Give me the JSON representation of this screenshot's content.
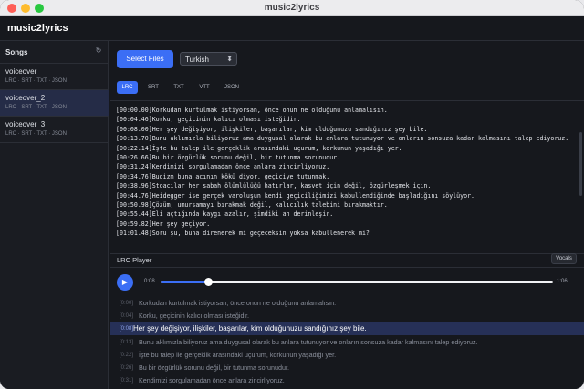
{
  "window": {
    "title": "music2lyrics"
  },
  "app": {
    "name": "music2lyrics"
  },
  "sidebar": {
    "title": "Songs",
    "refresh_icon": "refresh-icon",
    "songs": [
      {
        "name": "voiceover",
        "formats": "LRC · SRT · TXT · JSON"
      },
      {
        "name": "voiceover_2",
        "formats": "LRC · SRT · TXT · JSON"
      },
      {
        "name": "voiceover_3",
        "formats": "LRC · SRT · TXT · JSON"
      }
    ],
    "active_index": 1
  },
  "toolbar": {
    "select_files_label": "Select Files",
    "language_value": "Turkish",
    "language_chevron": "⬍"
  },
  "format_tabs": [
    {
      "label": "LRC",
      "active": true
    },
    {
      "label": "SRT",
      "active": false
    },
    {
      "label": "TXT",
      "active": false
    },
    {
      "label": "VTT",
      "active": false
    },
    {
      "label": "JSON",
      "active": false
    }
  ],
  "lyrics_lines": [
    "[00:00.00]Korkudan kurtulmak istiyorsan, önce onun ne olduğunu anlamalısın.",
    "[00:04.46]Korku, geçicinin kalıcı olması isteğidir.",
    "[00:08.00]Her şey değişiyor, ilişkiler, başarılar, kim olduğunuzu sandığınız şey bile.",
    "[00:13.70]Bunu aklımızla biliyoruz ama duygusal olarak bu anlara tutunuyor ve onların sonsuza kadar kalmasını talep ediyoruz.",
    "[00:22.14]İşte bu talep ile gerçeklik arasındaki uçurum, korkunun yaşadığı yer.",
    "[00:26.66]Bu bir özgürlük sorunu değil, bir tutunma sorunudur.",
    "[00:31.24]Kendimizi sorgulamadan önce anlara zincirliyoruz.",
    "[00:34.76]Budizm buna acının kökü diyor, geçiciye tutunmak.",
    "[00:38.96]Stoacılar her sabah ölümlülüğü hatırlar, kasvet için değil, özgürleşmek için.",
    "[00:44.76]Heidegger ise gerçek varoluşun kendi geçiciliğimizi kabullendiğinde başladığını söylüyor.",
    "[00:50.98]Çözüm, umursamayı bırakmak değil, kalıcılık talebini bırakmaktır.",
    "[00:55.44]Eli açtığında kaygı azalır, şimdiki an derinleşir.",
    "[00:59.82]Her şey geçiyor.",
    "[01:01.48]Soru şu, buna direnerek mi geçeceksin yoksa kabullenerek mi?"
  ],
  "player": {
    "title": "LRC Player",
    "vocals_label": "Vocals",
    "play_icon": "▶",
    "current_time": "0:08",
    "duration": "1:06",
    "progress": 0.121,
    "lines": [
      {
        "ts": "[0:00]",
        "text": "Korkudan kurtulmak istiyorsan, önce onun ne olduğunu anlamalısın.",
        "current": false
      },
      {
        "ts": "[0:04]",
        "text": "Korku, geçicinin kalıcı olması isteğidir.",
        "current": false
      },
      {
        "ts": "[0:08]",
        "text": "Her şey değişiyor, ilişkiler, başarılar, kim olduğunuzu sandığınız şey bile.",
        "current": true
      },
      {
        "ts": "[0:13]",
        "text": "Bunu aklımızla biliyoruz ama duygusal olarak bu anlara tutunuyor ve onların sonsuza kadar kalmasını talep ediyoruz.",
        "current": false
      },
      {
        "ts": "[0:22]",
        "text": "İşte bu talep ile gerçeklik arasındaki uçurum, korkunun yaşadığı yer.",
        "current": false
      },
      {
        "ts": "[0:26]",
        "text": "Bu bir özgürlük sorunu değil, bir tutunma sorunudur.",
        "current": false
      },
      {
        "ts": "[0:31]",
        "text": "Kendimizi sorgulamadan önce anlara zincirliyoruz.",
        "current": false
      }
    ]
  },
  "colors": {
    "accent": "#3b6ef5",
    "background": "#16181d",
    "sidebar": "#1a1c22",
    "active_row": "#252c47"
  }
}
